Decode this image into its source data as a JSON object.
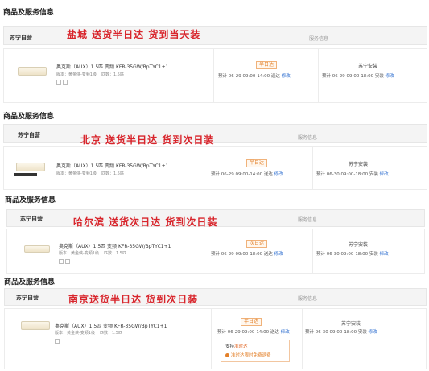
{
  "common": {
    "section_title": "商品及服务信息",
    "store": "苏宁自营",
    "service_header": "服务信息",
    "product_name": "奥克斯（AUX）1.5匹 变频 KFR-35GW/BpTYC1+1",
    "version_label": "版本：黄金侠-变频1级",
    "pieces_label": "匹数：1.5匹",
    "install_label": "苏宁安装",
    "edit_link": "修改",
    "delivery_suffix": "送达"
  },
  "panels": [
    {
      "overlay": "盐城  送货半日达  货到当天装",
      "badge": "半日达",
      "eta": "预计 06-29 09:00-14:00",
      "install_eta": "预计 06-29 09:00-18:00 安装"
    },
    {
      "overlay": "北京  送货半日达  货到次日装",
      "badge": "半日达",
      "eta": "预计 06-29 09:00-14:00",
      "install_eta": "预计 06-30 09:00-18:00 安装"
    },
    {
      "overlay": "哈尔滨  送货次日达  货到次日装",
      "badge": "次日达",
      "eta": "预计 06-29 09:00-18:00",
      "install_eta": "预计 06-30 09:00-18:00 安装"
    },
    {
      "overlay": "南京送货半日达  货到次日装",
      "badge": "半日达",
      "eta": "预计 06-29 09:00-14:00",
      "install_eta": "预计 06-30 09:00-18:00 安装",
      "tip_line1_prefix": "支持",
      "tip_line1_highlight": "准时达",
      "tip_line2": "准时达限时免费退费"
    }
  ]
}
